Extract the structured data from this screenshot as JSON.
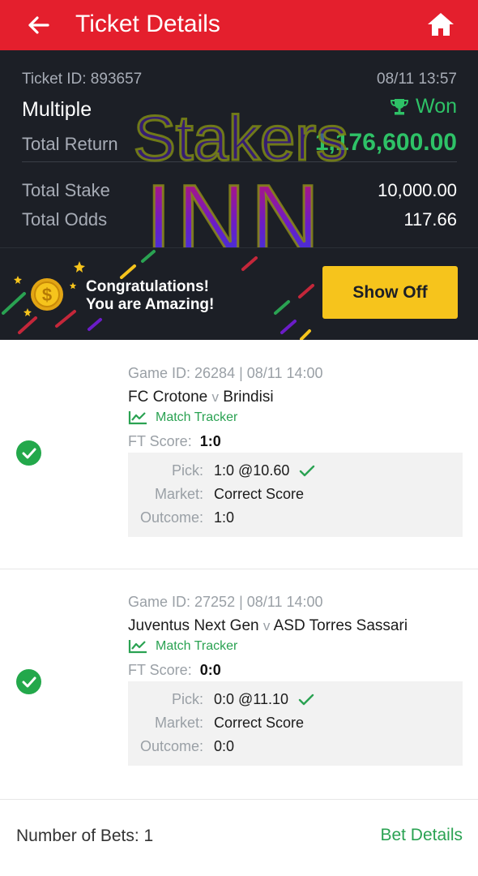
{
  "header": {
    "title": "Ticket Details"
  },
  "summary": {
    "ticket_id": "Ticket ID: 893657",
    "datetime": "08/11 13:57",
    "bet_type": "Multiple",
    "status": "Won",
    "total_return_label": "Total Return",
    "total_return": "1,176,600.00",
    "total_stake_label": "Total Stake",
    "total_stake": "10,000.00",
    "total_odds_label": "Total Odds",
    "total_odds": "117.66"
  },
  "watermark": {
    "line1": "Stakers",
    "line2": "INN"
  },
  "promo": {
    "line1": "Congratulations!",
    "line2": "You are Amazing!",
    "button": "Show Off"
  },
  "bets": [
    {
      "game": "Game ID: 26284 | 08/11 14:00",
      "home": "FC Crotone",
      "vs": "v",
      "away": "Brindisi",
      "tracker": "Match Tracker",
      "ft_label": "FT Score:",
      "ft_score": "1:0",
      "pick_label": "Pick:",
      "pick": "1:0 @10.60",
      "market_label": "Market:",
      "market": "Correct Score",
      "outcome_label": "Outcome:",
      "outcome": "1:0"
    },
    {
      "game": "Game ID: 27252 | 08/11 14:00",
      "home": "Juventus Next Gen",
      "vs": "v",
      "away": "ASD Torres Sassari",
      "tracker": "Match Tracker",
      "ft_label": "FT Score:",
      "ft_score": "0:0",
      "pick_label": "Pick:",
      "pick": "0:0 @11.10",
      "market_label": "Market:",
      "market": "Correct Score",
      "outcome_label": "Outcome:",
      "outcome": "0:0"
    }
  ],
  "footer": {
    "num_bets": "Number of Bets: 1",
    "bet_details": "Bet Details"
  },
  "colors": {
    "header_red": "#e41f2d",
    "dark_panel": "#1c1f26",
    "won_green": "#2ec267",
    "accent_green": "#2aa252",
    "button_yellow": "#f6c41c"
  },
  "icons": {
    "back": "arrow-left-icon",
    "home": "home-icon",
    "trophy": "trophy-icon",
    "coin": "dollar-coin-icon",
    "tracker": "line-chart-icon",
    "check": "check-circle-icon",
    "tick": "checkmark-icon"
  }
}
